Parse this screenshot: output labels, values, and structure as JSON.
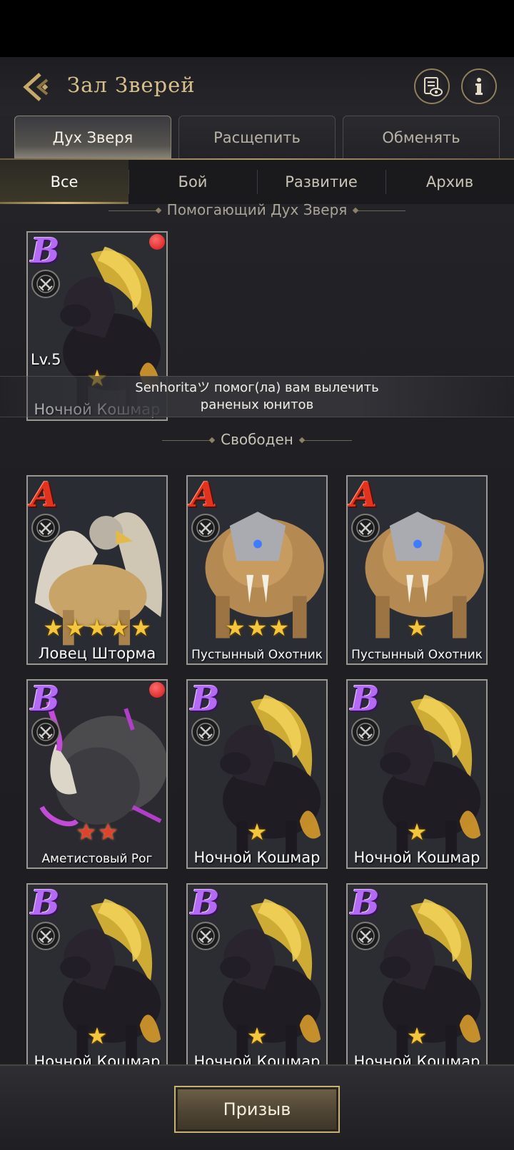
{
  "header": {
    "title": "Зал Зверей"
  },
  "main_tabs": [
    {
      "label": "Дух Зверя",
      "active": true
    },
    {
      "label": "Расщепить",
      "active": false
    },
    {
      "label": "Обменять",
      "active": false
    }
  ],
  "sub_tabs": [
    {
      "label": "Все",
      "active": true
    },
    {
      "label": "Бой",
      "active": false
    },
    {
      "label": "Развитие",
      "active": false
    },
    {
      "label": "Архив",
      "active": false
    }
  ],
  "sections": {
    "helping": "Помогающий Дух Зверя",
    "free": "Свободен"
  },
  "helper_card": {
    "grade": "B",
    "level": "Lv.5",
    "name": "Ночной Кошмар",
    "stars": 1,
    "notify": true,
    "beast": "nightmare-horse"
  },
  "toast": {
    "line1": "Senhoritaツ помог(ла) вам вылечить",
    "line2": "раненых юнитов"
  },
  "free_cards": [
    {
      "grade": "A",
      "name": "Ловец Шторма",
      "stars": 5,
      "star_color": "gold",
      "notify": false,
      "beast": "griffin"
    },
    {
      "grade": "A",
      "name": "Пустынный Охотник",
      "stars": 3,
      "star_color": "gold",
      "notify": false,
      "beast": "sabertooth"
    },
    {
      "grade": "A",
      "name": "Пустынный Охотник",
      "stars": 1,
      "star_color": "gold",
      "notify": false,
      "beast": "sabertooth"
    },
    {
      "grade": "B",
      "name": "Аметистовый Рог",
      "stars": 2,
      "star_color": "red",
      "notify": true,
      "beast": "amethyst-rhino"
    },
    {
      "grade": "B",
      "name": "Ночной Кошмар",
      "stars": 1,
      "star_color": "gold",
      "notify": false,
      "beast": "nightmare-horse"
    },
    {
      "grade": "B",
      "name": "Ночной Кошмар",
      "stars": 1,
      "star_color": "gold",
      "notify": false,
      "beast": "nightmare-horse"
    },
    {
      "grade": "B",
      "name": "Ночной Кошмар",
      "stars": 1,
      "star_color": "gold",
      "notify": false,
      "beast": "nightmare-horse"
    },
    {
      "grade": "B",
      "name": "Ночной Кошмар",
      "stars": 1,
      "star_color": "gold",
      "notify": false,
      "beast": "nightmare-horse"
    },
    {
      "grade": "B",
      "name": "Ночной Кошмар",
      "stars": 1,
      "star_color": "gold",
      "notify": false,
      "beast": "nightmare-horse"
    }
  ],
  "bottom": {
    "summon_label": "Призыв"
  },
  "icons": {
    "back": "back-arrow-icon",
    "view": "scroll-eye-icon",
    "info": "info-icon",
    "badge": "crossed-swords-icon",
    "star": "star-icon"
  },
  "colors": {
    "accent_gold": "#d8c08c",
    "grade_a": "#e2331f",
    "grade_b": "#b46af5",
    "notify": "#d01616"
  }
}
